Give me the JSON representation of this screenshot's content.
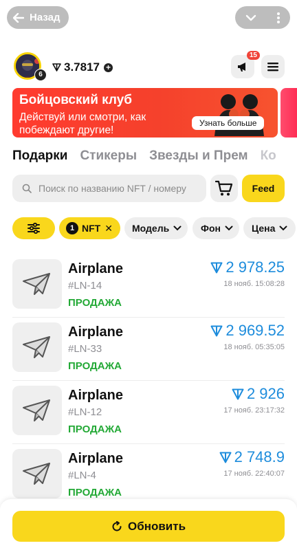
{
  "topbar": {
    "back_label": "Назад"
  },
  "profile": {
    "level": "6",
    "balance": "3.7817",
    "notif_count": "15"
  },
  "banner": {
    "title": "Бойцовский клуб",
    "subtitle": "Действуй или смотри, как побеждают другие!",
    "button_label": "Узнать больше"
  },
  "tabs": [
    {
      "label": "Подарки"
    },
    {
      "label": "Стикеры"
    },
    {
      "label": "Звезды и Прем"
    },
    {
      "label": "Ко"
    }
  ],
  "search": {
    "placeholder": "Поиск по названию NFT / номеру"
  },
  "feed_label": "Feed",
  "filters": {
    "nft_count": "1",
    "nft_label": "NFT",
    "model_label": "Модель",
    "background_label": "Фон",
    "price_label": "Цена"
  },
  "items": [
    {
      "name": "Airplane",
      "number": "#LN-14",
      "status": "ПРОДАЖА",
      "price": "2 978.25",
      "time": "18 нояб. 15:08:28"
    },
    {
      "name": "Airplane",
      "number": "#LN-33",
      "status": "ПРОДАЖА",
      "price": "2 969.52",
      "time": "18 нояб. 05:35:05"
    },
    {
      "name": "Airplane",
      "number": "#LN-12",
      "status": "ПРОДАЖА",
      "price": "2 926",
      "time": "17 нояб. 23:17:32"
    },
    {
      "name": "Airplane",
      "number": "#LN-4",
      "status": "ПРОДАЖА",
      "price": "2 748.9",
      "time": "17 нояб. 22:40:07"
    }
  ],
  "refresh_label": "Обновить",
  "colors": {
    "accent_yellow": "#f9d71c",
    "price_blue": "#1d8cdc",
    "status_green": "#23a936",
    "banner_red": "#f5412c"
  }
}
